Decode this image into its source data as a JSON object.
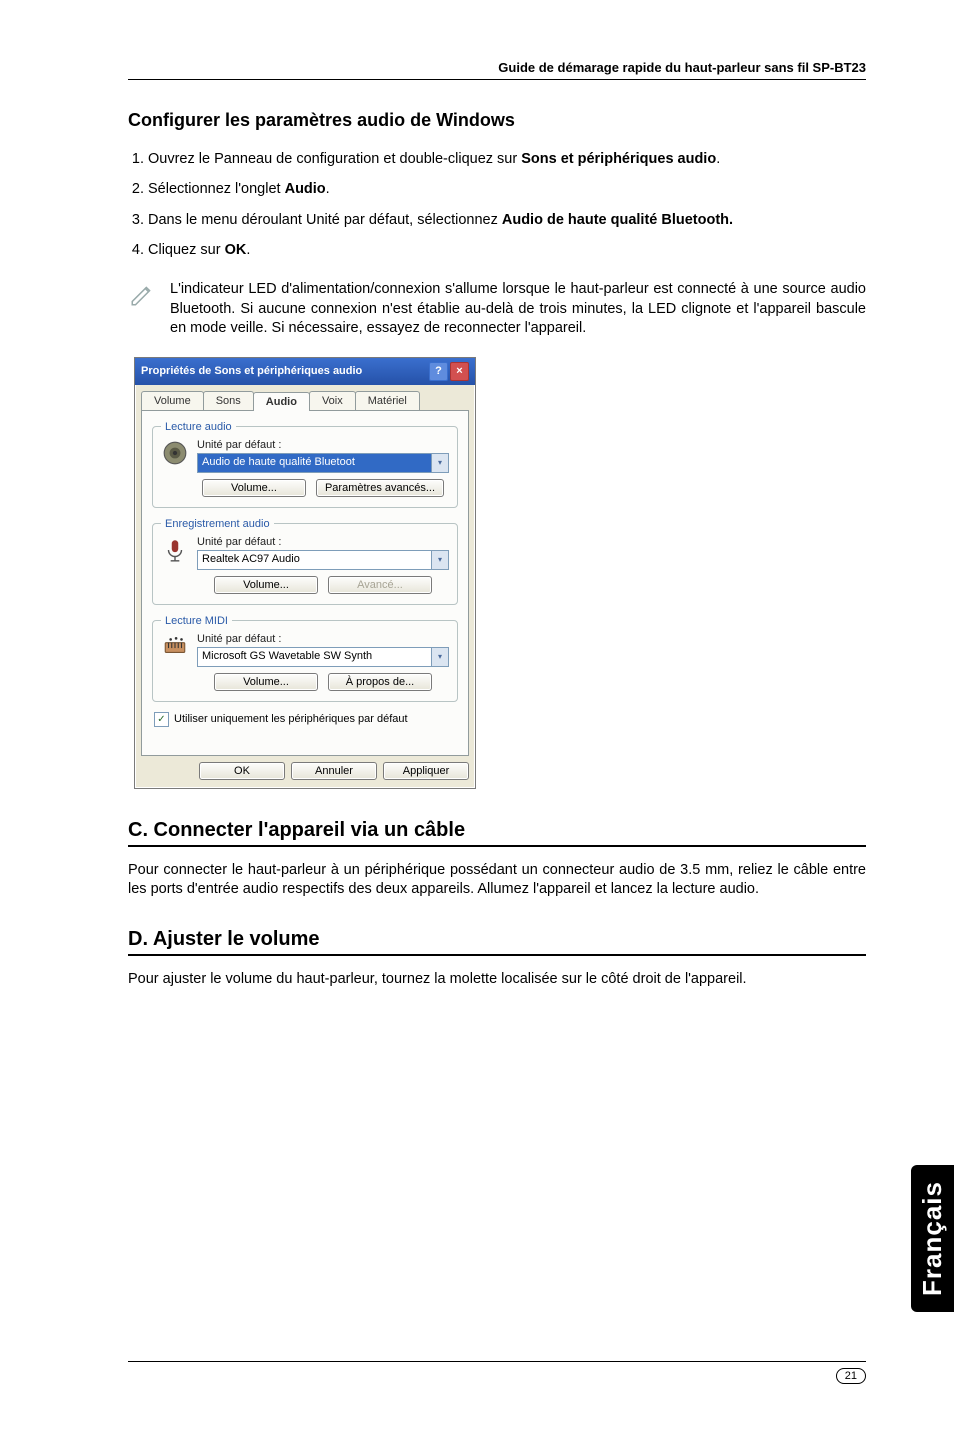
{
  "header": {
    "title": "Guide de démarage rapide du haut-parleur sans fil SP-BT23"
  },
  "section_config": {
    "heading": "Configurer les paramètres audio de Windows",
    "steps": [
      {
        "pre": "Ouvrez le Panneau de configuration et double-cliquez sur ",
        "bold": "Sons et périphériques audio",
        "post": "."
      },
      {
        "pre": "Sélectionnez l'onglet ",
        "bold": "Audio",
        "post": "."
      },
      {
        "pre": "Dans le menu déroulant Unité par défaut, sélectionnez ",
        "bold": "Audio de haute qualité Bluetooth.",
        "post": ""
      },
      {
        "pre": "Cliquez sur ",
        "bold": "OK",
        "post": "."
      }
    ],
    "note": "L'indicateur LED d'alimentation/connexion s'allume lorsque le haut-parleur est connecté à une source audio Bluetooth. Si aucune connexion n'est établie au-delà de  trois minutes, la LED clignote et l'appareil bascule en mode veille. Si nécessaire, essayez de reconnecter l'appareil."
  },
  "dialog": {
    "title": "Propriétés de Sons et périphériques audio",
    "tabs": [
      "Volume",
      "Sons",
      "Audio",
      "Voix",
      "Matériel"
    ],
    "active_tab_index": 2,
    "groups": {
      "playback": {
        "legend": "Lecture audio",
        "label": "Unité par défaut :",
        "value": "Audio de haute qualité Bluetoot",
        "btn1": "Volume...",
        "btn2": "Paramètres avancés..."
      },
      "record": {
        "legend": "Enregistrement audio",
        "label": "Unité par défaut :",
        "value": "Realtek AC97 Audio",
        "btn1": "Volume...",
        "btn2": "Avancé..."
      },
      "midi": {
        "legend": "Lecture MIDI",
        "label": "Unité par défaut :",
        "value": "Microsoft GS Wavetable SW Synth",
        "btn1": "Volume...",
        "btn2": "À propos de..."
      }
    },
    "checkbox": "Utiliser uniquement les périphériques par défaut",
    "footer": {
      "ok": "OK",
      "cancel": "Annuler",
      "apply": "Appliquer"
    }
  },
  "section_c": {
    "heading": "C. Connecter l'appareil via un câble",
    "body": "Pour connecter le haut-parleur à un périphérique possédant un connecteur audio de 3.5 mm, reliez le câble entre les ports d'entrée audio respectifs des deux appareils. Allumez l'appareil et lancez la lecture audio."
  },
  "section_d": {
    "heading": "D. Ajuster le volume",
    "body": "Pour ajuster le volume du haut-parleur, tournez la molette localisée sur le côté droit de l'appareil."
  },
  "side_tab": "Français",
  "page_number": "21"
}
